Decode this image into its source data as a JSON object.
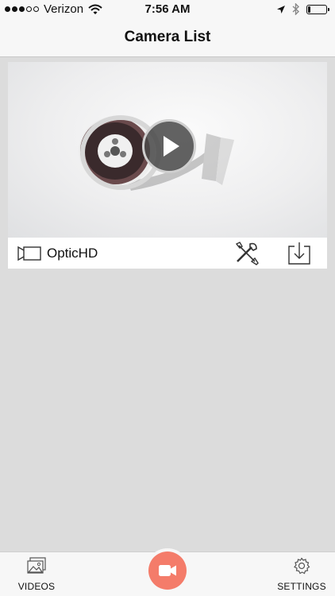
{
  "status_bar": {
    "carrier": "Verizon",
    "time": "7:56 AM",
    "signal_bars_filled": 3,
    "signal_bars_total": 5,
    "battery_level": 0.15
  },
  "nav": {
    "title": "Camera List"
  },
  "camera": {
    "name": "OpticHD",
    "thumbnail": "film-reel-image",
    "icons": {
      "camera": "video-camera-icon",
      "tools": "tools-icon",
      "download": "download-icon",
      "play": "play-icon"
    }
  },
  "tab_bar": {
    "videos_label": "VIDEOS",
    "settings_label": "SETTINGS",
    "record_color": "#f47c6a"
  }
}
